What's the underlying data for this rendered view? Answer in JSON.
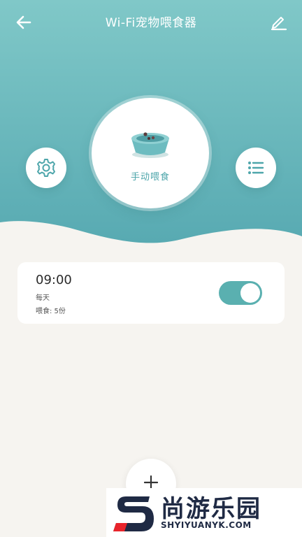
{
  "header": {
    "title": "Wi-Fi宠物喂食器",
    "back_icon": "arrow-left-icon",
    "edit_icon": "pencil-icon"
  },
  "feeder": {
    "manual_feed_label": "手动喂食",
    "bowl_icon": "pet-bowl-icon"
  },
  "actions": {
    "settings_icon": "gear-icon",
    "list_icon": "list-icon"
  },
  "schedule": [
    {
      "time": "09:00",
      "repeat": "每天",
      "amount": "喂食: 5份",
      "enabled": true
    }
  ],
  "add_button": {
    "icon": "plus-icon"
  },
  "watermark": {
    "cn": "尚游乐园",
    "en": "SHYIYUANYK.COM"
  },
  "colors": {
    "accent": "#5ab0b0",
    "header_top": "#80c8c8",
    "header_bottom": "#5aabb2",
    "background": "#f6f4f0",
    "card": "#ffffff"
  }
}
